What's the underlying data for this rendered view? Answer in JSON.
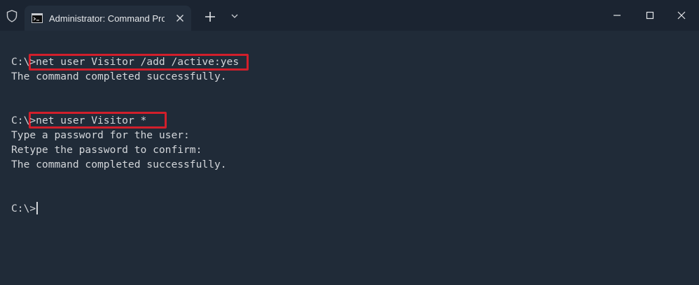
{
  "window": {
    "tab_title": "Administrator: Command Prom",
    "icons": {
      "shield": "shield-icon",
      "tab": "command-prompt-icon",
      "close_tab": "close-icon",
      "new_tab": "plus-icon",
      "dropdown": "chevron-down-icon",
      "minimize": "minimize-icon",
      "maximize": "maximize-icon",
      "close": "close-icon"
    }
  },
  "terminal": {
    "lines": [
      {
        "prompt": "C:\\>",
        "command": "net user Visitor /add /active:yes"
      },
      {
        "text": "The command completed successfully."
      },
      {
        "prompt": "C:\\>",
        "command": "net user Visitor *"
      },
      {
        "text": "Type a password for the user:"
      },
      {
        "text": "Retype the password to confirm:"
      },
      {
        "text": "The command completed successfully."
      },
      {
        "prompt": "C:\\>",
        "command": ""
      }
    ]
  },
  "colors": {
    "background": "#202b38",
    "titlebar": "#1b2431",
    "text": "#d3d6da",
    "highlight": "#d21f2b"
  }
}
